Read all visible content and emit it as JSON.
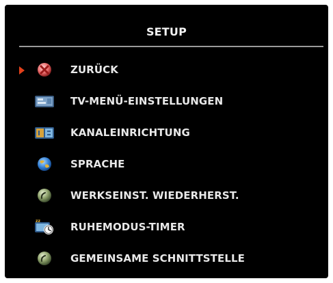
{
  "menu": {
    "title": "SETUP",
    "pointer_color": "#e2401a",
    "selected_index": 0,
    "items": [
      {
        "label": "ZURÜCK",
        "icon": "back-icon"
      },
      {
        "label": "TV-MENÜ-EINSTELLUNGEN",
        "icon": "tv-menu-settings-icon"
      },
      {
        "label": "KANALEINRICHTUNG",
        "icon": "channel-setup-icon"
      },
      {
        "label": "SPRACHE",
        "icon": "globe-icon"
      },
      {
        "label": "WERKSEINST. WIEDERHERST.",
        "icon": "factory-reset-icon"
      },
      {
        "label": "RUHEMODUS-TIMER",
        "icon": "sleep-timer-icon"
      },
      {
        "label": "GEMEINSAME SCHNITTSTELLE",
        "icon": "common-interface-icon"
      }
    ]
  }
}
